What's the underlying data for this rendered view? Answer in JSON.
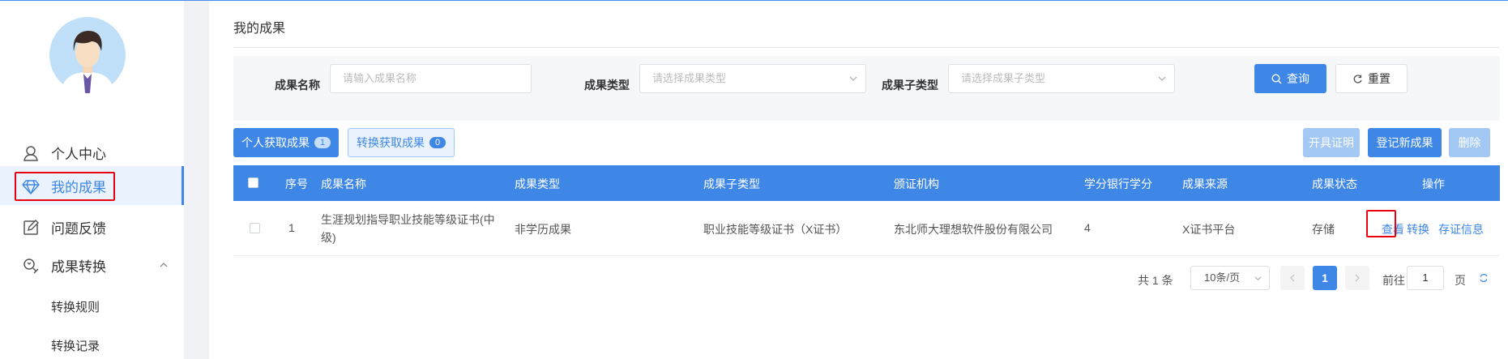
{
  "sidebar": {
    "items": [
      {
        "label": "个人中心",
        "icon": "user-icon"
      },
      {
        "label": "我的成果",
        "icon": "diamond-icon"
      },
      {
        "label": "问题反馈",
        "icon": "edit-icon"
      },
      {
        "label": "成果转换",
        "icon": "convert-icon"
      }
    ],
    "sub_items": [
      {
        "label": "转换规则"
      },
      {
        "label": "转换记录"
      }
    ]
  },
  "page": {
    "title": "我的成果"
  },
  "filters": {
    "name_label": "成果名称",
    "name_placeholder": "请输入成果名称",
    "type_label": "成果类型",
    "type_placeholder": "请选择成果类型",
    "subtype_label": "成果子类型",
    "subtype_placeholder": "请选择成果子类型",
    "query_label": "查询",
    "reset_label": "重置"
  },
  "tabs": [
    {
      "label": "个人获取成果",
      "count": "1"
    },
    {
      "label": "转换获取成果",
      "count": "0"
    }
  ],
  "actions": {
    "certify_label": "开具证明",
    "register_label": "登记新成果",
    "delete_label": "删除"
  },
  "table": {
    "headers": {
      "index": "序号",
      "name": "成果名称",
      "type": "成果类型",
      "subtype": "成果子类型",
      "issuer": "颁证机构",
      "credits": "学分银行学分",
      "source": "成果来源",
      "status": "成果状态",
      "ops": "操作"
    },
    "rows": [
      {
        "index": "1",
        "name": "生涯规划指导职业技能等级证书(中级)",
        "type": "非学历成果",
        "subtype": "职业技能等级证书（X证书）",
        "issuer": "东北师大理想软件股份有限公司",
        "credits": "4",
        "source": "X证书平台",
        "status": "存储",
        "op_view": "查看",
        "op_convert": "转换",
        "op_evidence": "存证信息"
      }
    ]
  },
  "pagination": {
    "total": "共 1 条",
    "page_size": "10条/页",
    "current": "1",
    "goto_prefix": "前往",
    "goto_value": "1",
    "goto_suffix": "页"
  },
  "colors": {
    "accent": "#3f87e6",
    "highlight": "#e60012"
  }
}
